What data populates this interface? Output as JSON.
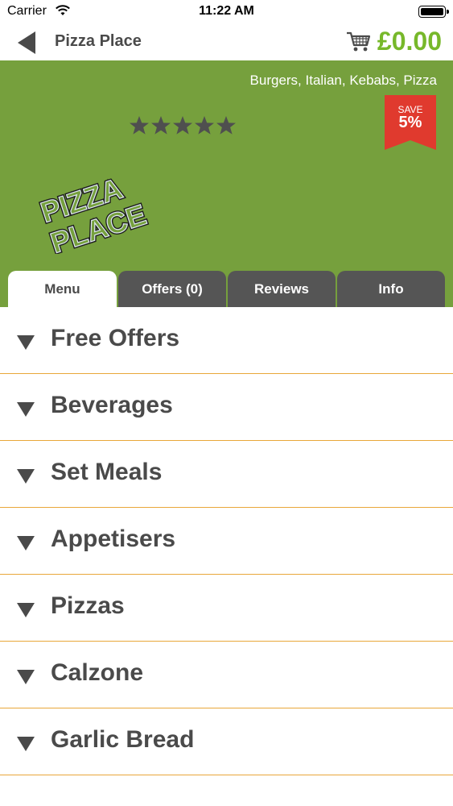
{
  "status_bar": {
    "carrier": "Carrier",
    "time": "11:22 AM"
  },
  "nav": {
    "title": "Pizza Place",
    "cart_total": "£0.00",
    "back_icon": "back-arrow-icon",
    "cart_icon": "shopping-cart-icon"
  },
  "restaurant": {
    "cuisines": "Burgers, Italian, Kebabs, Pizza",
    "rating_stars": 5,
    "save_label": "SAVE",
    "save_value": "5%",
    "logo_text": [
      "PIZZA",
      "PLACE"
    ]
  },
  "tabs": [
    {
      "label": "Menu",
      "active": true
    },
    {
      "label": "Offers (0)",
      "active": false
    },
    {
      "label": "Reviews",
      "active": false
    },
    {
      "label": "Info",
      "active": false
    }
  ],
  "menu": {
    "categories": [
      {
        "label": "Free Offers"
      },
      {
        "label": "Beverages"
      },
      {
        "label": "Set Meals"
      },
      {
        "label": "Appetisers"
      },
      {
        "label": "Pizzas"
      },
      {
        "label": "Calzone"
      },
      {
        "label": "Garlic Bread"
      }
    ]
  },
  "colors": {
    "brand_green": "#76a03d",
    "price_green": "#77b82a",
    "badge_red": "#e03a2e",
    "divider_orange": "#e9a73a",
    "tab_dark": "#555555"
  }
}
